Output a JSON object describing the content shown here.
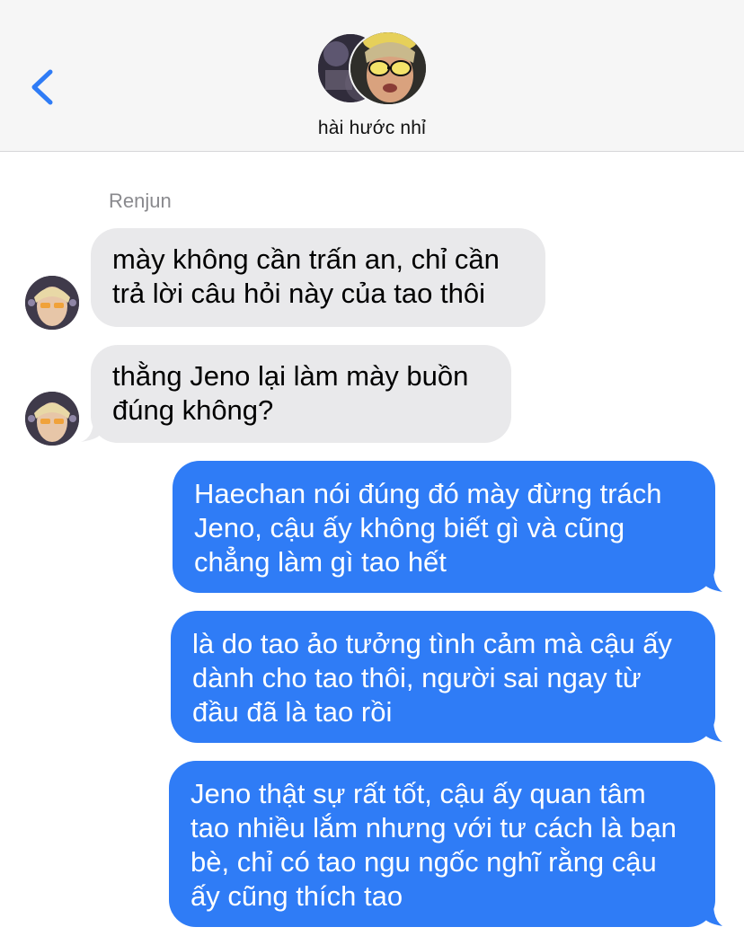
{
  "header": {
    "group_name": "hài hước nhỉ",
    "back_icon": "chevron-left-icon"
  },
  "colors": {
    "accent": "#2f7cf6",
    "incoming_bubble": "#e9e9eb",
    "header_bg": "#f6f6f6"
  },
  "messages": [
    {
      "direction": "incoming",
      "sender": "Renjun",
      "text": "mày không cần trấn an, chỉ cần\ntrả lời câu hỏi này của tao thôi"
    },
    {
      "direction": "incoming",
      "text": "thằng Jeno lại làm mày buồn\nđúng không?"
    },
    {
      "direction": "outgoing",
      "text": "Haechan nói đúng đó mày đừng trách\nJeno, cậu ấy không biết gì và cũng\nchẳng làm gì tao hết"
    },
    {
      "direction": "outgoing",
      "text": "là do tao ảo tưởng tình cảm mà cậu ấy\ndành cho tao thôi, người sai ngay từ\nđầu đã là tao rồi"
    },
    {
      "direction": "outgoing",
      "text": "Jeno thật sự rất tốt, cậu ấy quan tâm\ntao nhiều lắm nhưng với tư cách là bạn\nbè, chỉ có tao ngu ngốc nghĩ rằng cậu\nấy cũng thích tao"
    }
  ]
}
